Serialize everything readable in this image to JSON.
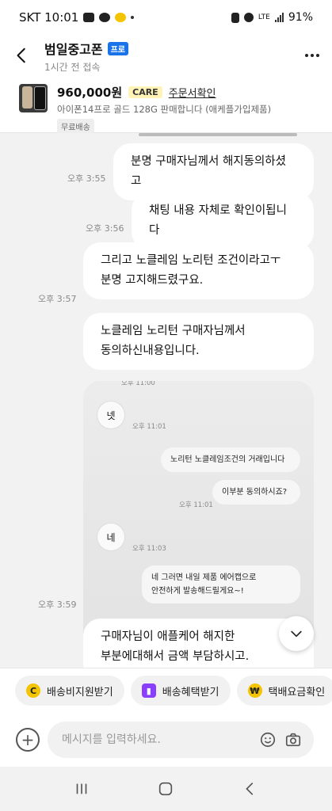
{
  "status_bar": {
    "carrier_time": "SKT 10:01",
    "network": "LTE",
    "battery": "91%"
  },
  "header": {
    "title": "범일중고폰",
    "badge": "프로",
    "subtitle": "1시간 전 접속"
  },
  "product": {
    "price": "960,000원",
    "care_badge": "CARE",
    "order_link": "주문서확인",
    "description": "아이폰14프로 골드 128G 판매합니다 (애케플가입제품)",
    "shipping_tag": "무료배송"
  },
  "messages": [
    {
      "text": "분명 구매자님께서 해지동의하셨고",
      "time": "오후 3:55"
    },
    {
      "text": "채팅 내용 자체로 확인이됩니다",
      "time": "오후 3:56"
    },
    {
      "line1": "그리고 노클레임 노리턴 조건이라고ㅜ",
      "line2": "분명 고지해드렸구요.",
      "time": "오후 3:57"
    },
    {
      "line1": "노클레임 노리턴 구매자님께서",
      "line2": "동의하신내용입니다."
    },
    {
      "time": "오후 3:59"
    },
    {
      "line1": "구매자님이 애플케어 해지한",
      "line2": "부분에대해서 금액 부담하시고."
    }
  ],
  "embedded_screenshot": {
    "top_time": "오후 11:00",
    "msg1": "넷",
    "time1": "오후 11:01",
    "bubble1": "노리턴 노클레임조건의 거래입니다",
    "bubble2": "이부분 동의하시죠?",
    "time2": "오후 11:01",
    "msg2": "네",
    "time3": "오후 11:03",
    "bubble3_line1": "네 그러면 내일 제품 에어캡으로",
    "bubble3_line2": "안전하게 발송해드릴게요~!"
  },
  "chips": [
    {
      "label": "배송비지원받기",
      "icon": "coin-c-icon",
      "color": "#f4c400"
    },
    {
      "label": "배송혜택받기",
      "icon": "gift-icon",
      "color": "#8a3ffc"
    },
    {
      "label": "택배요금확인",
      "icon": "won-coin-icon",
      "color": "#f4c400"
    }
  ],
  "input": {
    "placeholder": "메시지를 입력하세요."
  }
}
